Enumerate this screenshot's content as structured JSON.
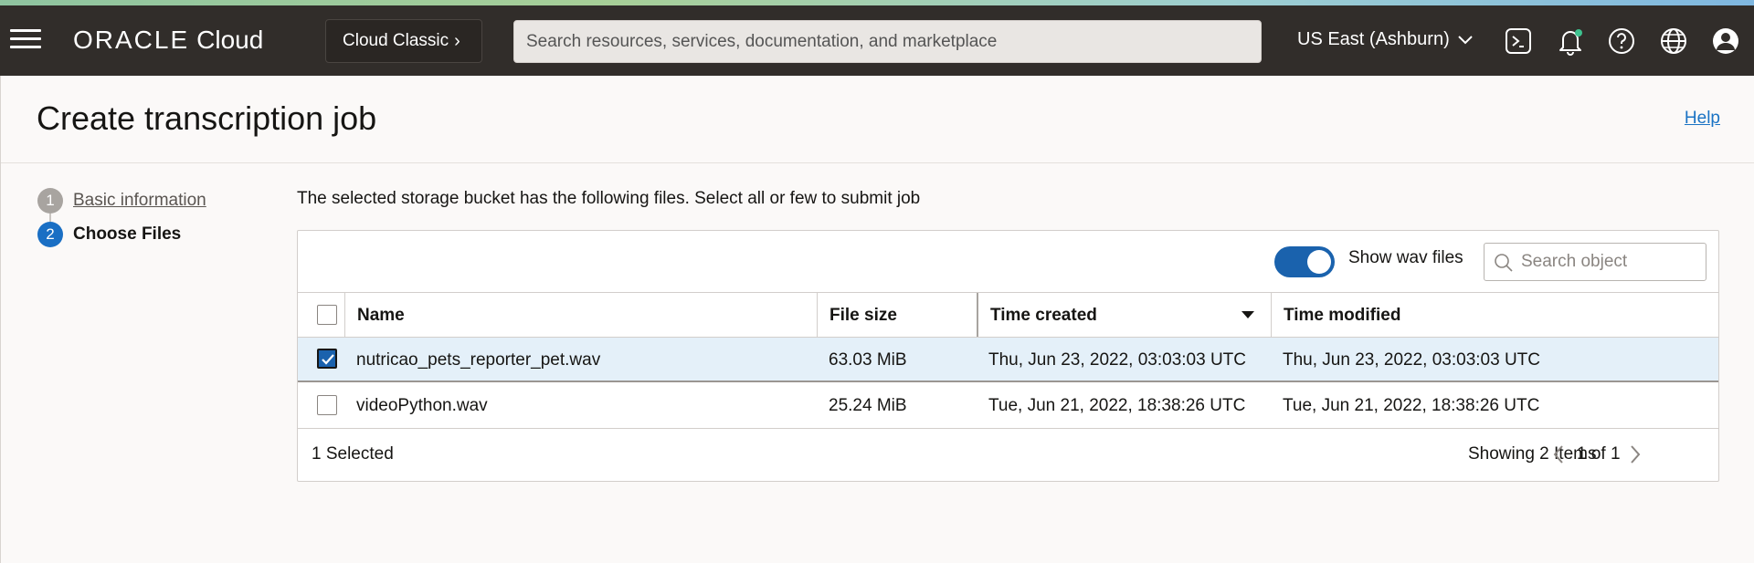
{
  "topbar": {
    "brand_oracle": "ORACLE",
    "brand_cloud": "Cloud",
    "classic_label": "Cloud Classic",
    "search_placeholder": "Search resources, services, documentation, and marketplace",
    "region": "US East (Ashburn)",
    "icons": [
      "cloud-shell-icon",
      "bell-icon",
      "help-icon",
      "globe-icon",
      "user-icon"
    ]
  },
  "header": {
    "title": "Create transcription job",
    "help_link": "Help"
  },
  "steps": [
    {
      "number": "1",
      "label": "Basic information",
      "state": "completed"
    },
    {
      "number": "2",
      "label": "Choose Files",
      "state": "current"
    }
  ],
  "intro": "The selected storage bucket has the following files. Select all or few to submit job",
  "toolbar": {
    "toggle_label": "Show wav files",
    "toggle_on": true,
    "search_placeholder": "Search object"
  },
  "table": {
    "columns": [
      "Name",
      "File size",
      "Time created",
      "Time modified"
    ],
    "sorted_column": "Time created",
    "rows": [
      {
        "name": "nutricao_pets_reporter_pet.wav",
        "size": "63.03 MiB",
        "created": "Thu, Jun 23, 2022, 03:03:03 UTC",
        "modified": "Thu, Jun 23, 2022, 03:03:03 UTC",
        "selected": true
      },
      {
        "name": "videoPython.wav",
        "size": "25.24 MiB",
        "created": "Tue, Jun 21, 2022, 18:38:26 UTC",
        "modified": "Tue, Jun 21, 2022, 18:38:26 UTC",
        "selected": false
      }
    ]
  },
  "footer": {
    "selected_count": "1 Selected",
    "showing": "Showing 2 Items",
    "page": "1 of 1"
  },
  "colors": {
    "topbar_bg": "#312d2a",
    "accent": "#1a62ad",
    "selected_row": "#e4f0f9",
    "link": "#1a73c4"
  }
}
